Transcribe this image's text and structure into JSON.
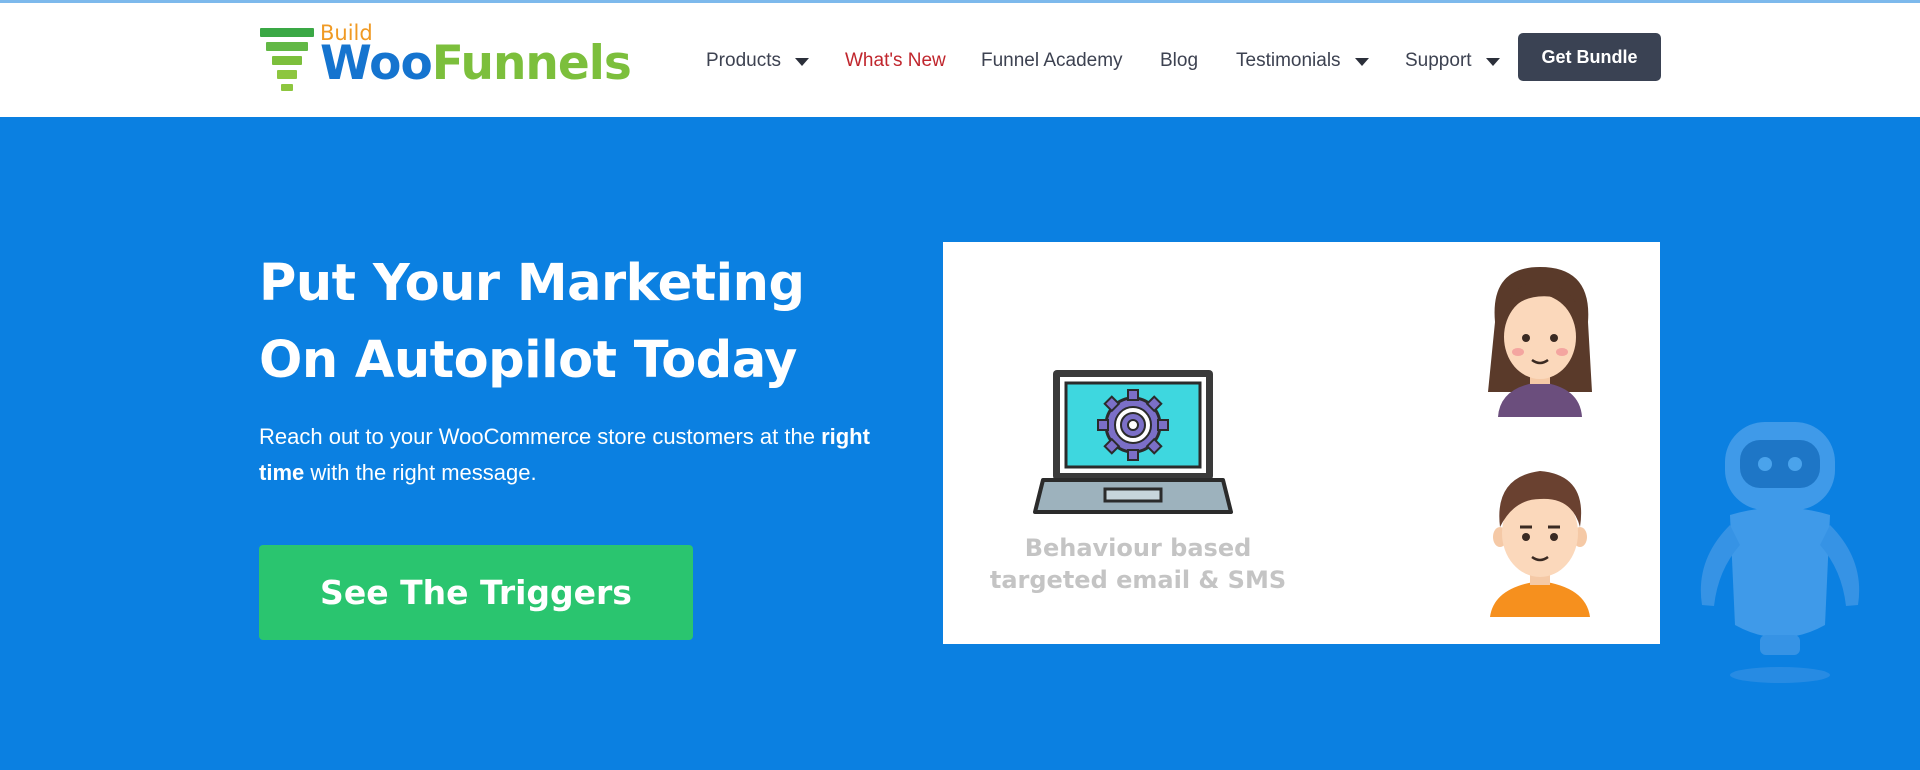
{
  "logo": {
    "build": "Build",
    "woo": "Woo",
    "funnels": "Funnels"
  },
  "nav": {
    "items": [
      {
        "label": "Products",
        "dropdown": true
      },
      {
        "label": "What's New",
        "dropdown": false,
        "highlight": true
      },
      {
        "label": "Funnel Academy",
        "dropdown": false
      },
      {
        "label": "Blog",
        "dropdown": false
      },
      {
        "label": "Testimonials",
        "dropdown": true
      },
      {
        "label": "Support",
        "dropdown": true
      }
    ],
    "cta_label": "Get Bundle"
  },
  "hero": {
    "title": "Put Your Marketing On Autopilot Today",
    "subtitle_start": "Reach out to your WooCommerce store customers at the ",
    "subtitle_bold": "right time",
    "subtitle_end": " with the right message.",
    "cta_label": "See The Triggers"
  },
  "illustration": {
    "caption_line1": "Behaviour based",
    "caption_line2": "targeted email & SMS"
  },
  "colors": {
    "hero_background": "#0b80e1",
    "header_background": "#ffffff",
    "cta_green": "#2ac56f",
    "bundle_button": "#3a4253",
    "highlight_red": "#c0262d",
    "logo_blue": "#1574cf",
    "logo_green": "#7cbf3c",
    "logo_orange": "#f09a24"
  },
  "icons": [
    "funnel-logo-icon",
    "chevron-down-icon",
    "laptop-gear-icon",
    "woman-avatar-icon",
    "man-avatar-icon",
    "robot-icon"
  ]
}
